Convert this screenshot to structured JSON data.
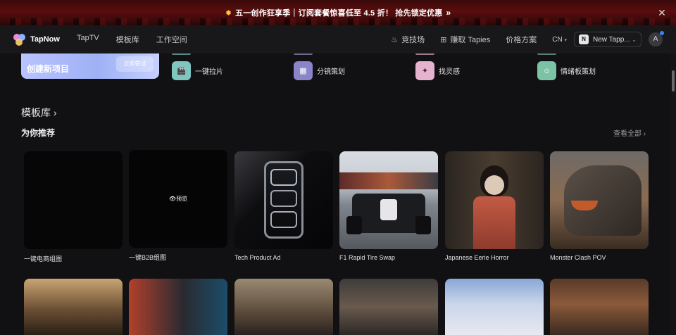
{
  "promo_banner": {
    "text": "五一创作狂享季｜订阅套餐惊喜低至 4.5 折！ 抢先锁定优惠",
    "sun_icon": "sun-icon",
    "arrow": "»",
    "close": "✕"
  },
  "nav": {
    "logo_text": "TapNow",
    "links": [
      "TapTV",
      "模板库",
      "工作空间"
    ],
    "arena": "竞技场",
    "earn": "赚取 Tapies",
    "pricing": "价格方案",
    "lang": "CN",
    "team_badge": "N",
    "team_name": "New Tapp...",
    "avatar": "A"
  },
  "quick_create": {
    "title": "创建新项目",
    "button": "立即尝试"
  },
  "tools": [
    {
      "label": "一键拉片",
      "icon": "clapper-icon",
      "color": "#7fc6c0"
    },
    {
      "label": "分镜策划",
      "icon": "grid-icon",
      "color": "#8a84c9"
    },
    {
      "label": "找灵感",
      "icon": "sparkle-icon",
      "color": "#e6b3cf"
    },
    {
      "label": "情绪板策划",
      "icon": "smile-icon",
      "color": "#7cc3a6"
    }
  ],
  "library": {
    "title": "模板库 ›",
    "section": "为你推荐",
    "view_all": "查看全部 ›",
    "preview_label": "👁预览",
    "cards": [
      {
        "label": "一键电商组图"
      },
      {
        "label": "一键B2B组图"
      },
      {
        "label": "Tech Product Ad"
      },
      {
        "label": "F1 Rapid Tire Swap"
      },
      {
        "label": "Japanese Eerie Horror"
      },
      {
        "label": "Monster Clash POV"
      }
    ]
  }
}
